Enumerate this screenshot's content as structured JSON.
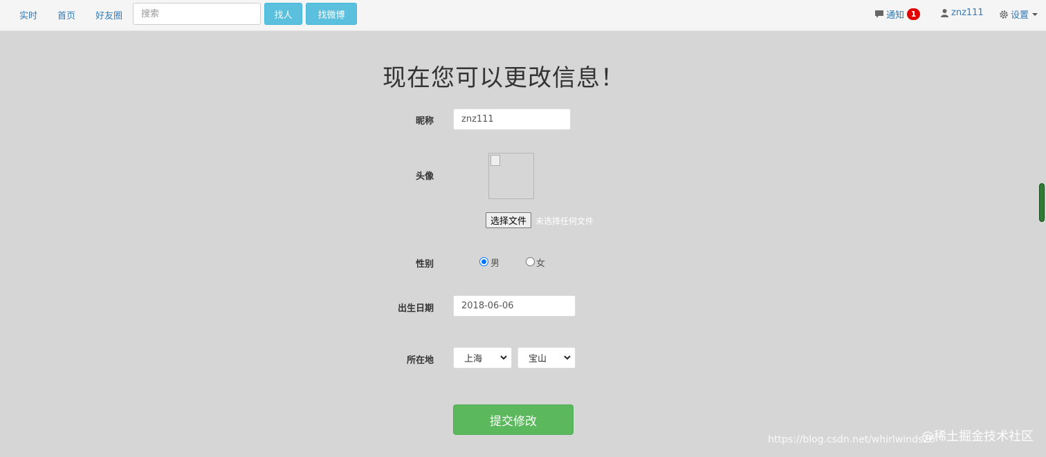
{
  "nav": {
    "links": [
      "实时",
      "首页",
      "好友圈"
    ],
    "search_placeholder": "搜索",
    "buttons": [
      "找人",
      "找微博"
    ],
    "notifications": {
      "label": "通知",
      "count": "1"
    },
    "username": "znz111",
    "settings": "设置"
  },
  "page": {
    "title": "现在您可以更改信息！"
  },
  "form": {
    "nickname": {
      "label": "昵称",
      "value": "znz111"
    },
    "avatar": {
      "label": "头像",
      "file_button": "选择文件",
      "file_status": "未选择任何文件"
    },
    "gender": {
      "label": "性别",
      "options": [
        "男",
        "女"
      ],
      "selected": "男"
    },
    "birthdate": {
      "label": "出生日期",
      "value": "2018-06-06"
    },
    "location": {
      "label": "所在地",
      "province": "上海",
      "district": "宝山"
    },
    "submit": "提交修改"
  },
  "watermark": {
    "url": "https://blog.csdn.net/whirlwinds26",
    "brand": "@稀土掘金技术社区"
  },
  "colors": {
    "background": "#d6d6d6",
    "navbar": "#f5f5f5",
    "link": "#337ab7",
    "info_button": "#5bc0de",
    "submit_button": "#5cb85c",
    "badge": "#e00000"
  }
}
